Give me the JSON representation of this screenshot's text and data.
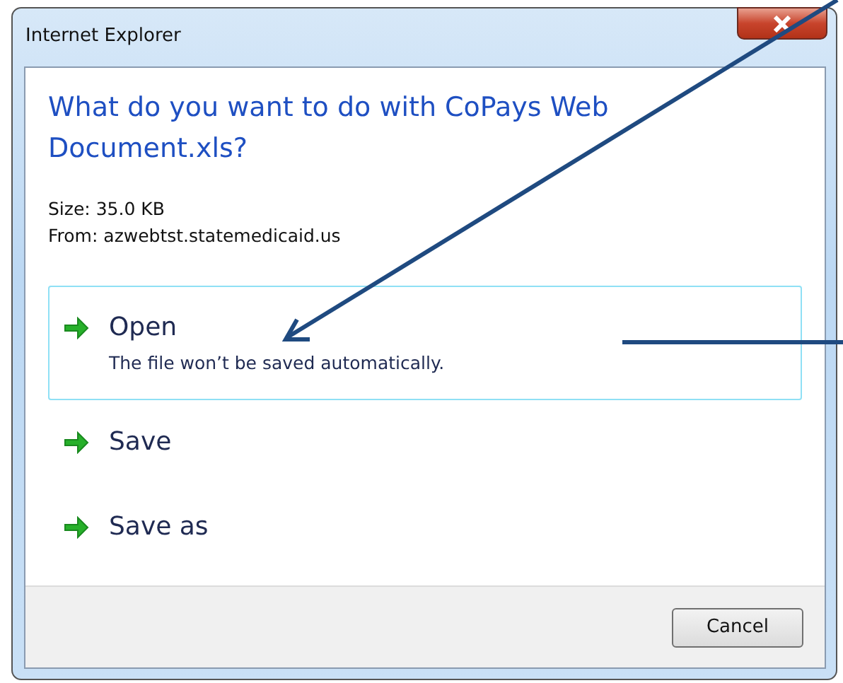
{
  "window": {
    "title": "Internet Explorer"
  },
  "question": "What do you want to do with CoPays Web Document.xls?",
  "details": [
    "Size: 35.0 KB",
    "From: azwebtst.statemedicaid.us"
  ],
  "options": [
    {
      "label": "Open",
      "description": "The file won’t be saved automatically.",
      "selected": true
    },
    {
      "label": "Save",
      "selected": false
    },
    {
      "label": "Save as",
      "selected": false
    }
  ],
  "buttons": [
    "Cancel"
  ]
}
